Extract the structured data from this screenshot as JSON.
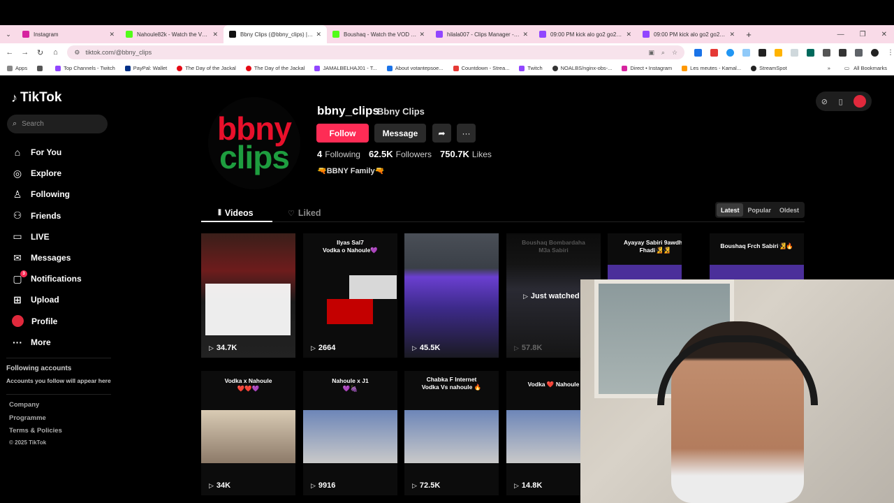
{
  "browser": {
    "tabs": [
      {
        "title": "Instagram",
        "color": "#d6249f"
      },
      {
        "title": "Nahoule82k - Watch the VOD o",
        "color": "#53fc18"
      },
      {
        "title": "Bbny Clips (@bbny_clips) | TikT",
        "color": "#111111"
      },
      {
        "title": "Boushaq - Watch the VOD on K",
        "color": "#53fc18"
      },
      {
        "title": "hilala007 - Clips Manager - Twi",
        "color": "#9146ff"
      },
      {
        "title": "09:00 PM kick alo go2 go2 go2",
        "color": "#9146ff"
      },
      {
        "title": "09:00 PM kick alo go2 go2 go2",
        "color": "#9146ff"
      }
    ],
    "url": "tiktok.com/@bbny_clips",
    "bookmarks": [
      {
        "label": "Apps",
        "color": "#888888"
      },
      {
        "label": "Top Channels - Twitch",
        "color": "#9146ff"
      },
      {
        "label": "PayPal: Wallet",
        "color": "#003087"
      },
      {
        "label": "The Day of the Jackal",
        "color": "#e50914"
      },
      {
        "label": "The Day of the Jackal",
        "color": "#e50914"
      },
      {
        "label": "JAMALBELHAJ01 - T...",
        "color": "#9146ff"
      },
      {
        "label": "About votantepsoe...",
        "color": "#1a73e8"
      },
      {
        "label": "Countdown - Strea...",
        "color": "#e53935"
      },
      {
        "label": "Twitch",
        "color": "#9146ff"
      },
      {
        "label": "NOALBS/nginx-obs-...",
        "color": "#333333"
      },
      {
        "label": "Direct • Instagram",
        "color": "#d6249f"
      },
      {
        "label": "Les meutes - Kamal...",
        "color": "#ff9800"
      },
      {
        "label": "StreamSpot",
        "color": "#222222"
      }
    ],
    "all_bookmarks": "All Bookmarks"
  },
  "sidebar": {
    "logo": "TikTok",
    "search_placeholder": "Search",
    "nav": [
      {
        "label": "For You",
        "icon": "home-icon"
      },
      {
        "label": "Explore",
        "icon": "compass-icon"
      },
      {
        "label": "Following",
        "icon": "user-follow-icon"
      },
      {
        "label": "Friends",
        "icon": "friends-icon"
      },
      {
        "label": "LIVE",
        "icon": "live-icon"
      },
      {
        "label": "Messages",
        "icon": "message-icon"
      },
      {
        "label": "Notifications",
        "icon": "bell-icon",
        "badge": "3"
      },
      {
        "label": "Upload",
        "icon": "plus-icon"
      },
      {
        "label": "Profile",
        "icon": "avatar-icon"
      },
      {
        "label": "More",
        "icon": "more-icon"
      }
    ],
    "following_accounts_title": "Following accounts",
    "following_accounts_sub": "Accounts you follow will appear here",
    "footer": [
      "Company",
      "Programme",
      "Terms & Policies",
      "© 2025 TikTok"
    ]
  },
  "profile": {
    "avatar_line1": "bbny",
    "avatar_line2": "clips",
    "username": "bbny_clips",
    "display_name": "Bbny Clips",
    "follow_label": "Follow",
    "message_label": "Message",
    "following_count": "4",
    "following_label": "Following",
    "followers_count": "62.5K",
    "followers_label": "Followers",
    "likes_count": "750.7K",
    "likes_label": "Likes",
    "bio": "🔫BBNY Family🔫"
  },
  "tabs": {
    "videos": "Videos",
    "liked": "Liked",
    "sort": [
      "Latest",
      "Popular",
      "Oldest"
    ],
    "sort_active": "Latest"
  },
  "videos": [
    {
      "caption": "",
      "views": "34.7K"
    },
    {
      "caption": "Ilyas Sal7\nVodka o Nahoule💜",
      "views": "2664"
    },
    {
      "caption": "",
      "views": "45.5K"
    },
    {
      "caption": "Boushaq Bombardaha\nM3a Sabiri",
      "views": "57.8K",
      "overlay": "Just watched"
    },
    {
      "caption": "Ayayay Sabiri 9awdha\nFhadi🧏🧏",
      "views": ""
    },
    {
      "caption": "Boushaq Frch Sabiri🧏🔥",
      "views": ""
    },
    {
      "caption": "Vodka x Nahoule\n❤️❤️💜",
      "views": "34K"
    },
    {
      "caption": "Nahoule x J1\n💜🍇",
      "views": "9916"
    },
    {
      "caption": "Chabka F Internet\nVodka Vs nahoule 🔥",
      "views": "72.5K"
    },
    {
      "caption": "Vodka ❤️ Nahoule",
      "views": "14.8K"
    }
  ],
  "colors": {
    "accent": "#fe2c55",
    "tab_bar": "#f9dbe8"
  }
}
